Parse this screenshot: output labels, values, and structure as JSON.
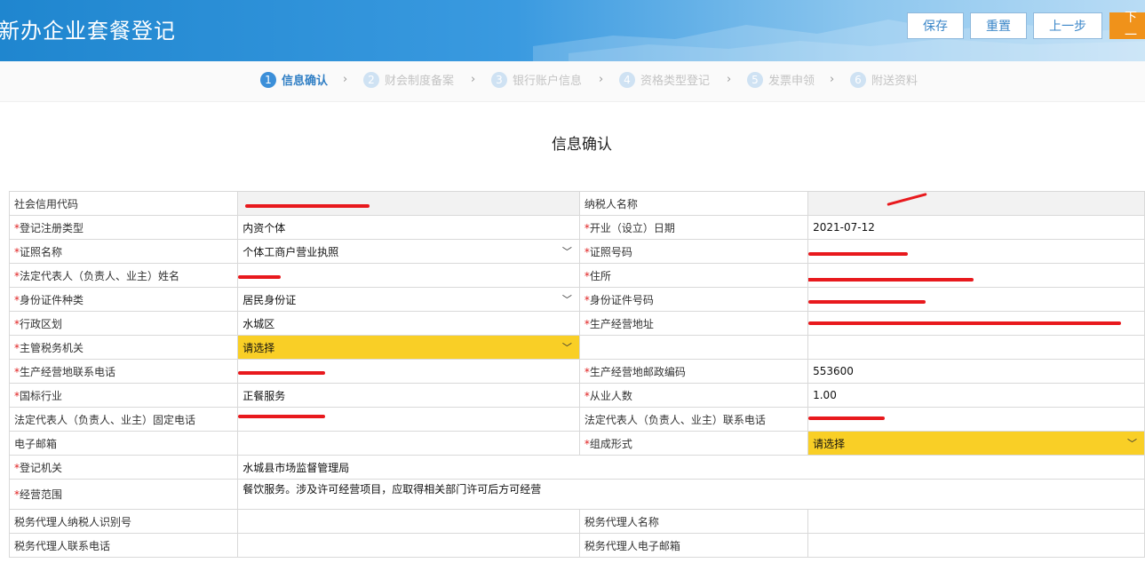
{
  "header": {
    "title": "新办企业套餐登记",
    "buttons": {
      "save": "保存",
      "reset": "重置",
      "prev": "上一步",
      "next": "下一"
    }
  },
  "steps": [
    {
      "num": "1",
      "label": "信息确认"
    },
    {
      "num": "2",
      "label": "财会制度备案"
    },
    {
      "num": "3",
      "label": "银行账户信息"
    },
    {
      "num": "4",
      "label": "资格类型登记"
    },
    {
      "num": "5",
      "label": "发票申领"
    },
    {
      "num": "6",
      "label": "附送资料"
    }
  ],
  "section_title": "信息确认",
  "form": {
    "credit_code": {
      "label": "社会信用代码",
      "value": ""
    },
    "taxpayer_name": {
      "label": "纳税人名称",
      "value": ""
    },
    "reg_type": {
      "label": "登记注册类型",
      "value": "内资个体"
    },
    "open_date": {
      "label": "开业（设立）日期",
      "value": "2021-07-12"
    },
    "license_name": {
      "label": "证照名称",
      "value": "个体工商户营业执照"
    },
    "license_no": {
      "label": "证照号码",
      "value": ""
    },
    "legal_name": {
      "label": "法定代表人（负责人、业主）姓名",
      "value": ""
    },
    "address": {
      "label": "住所",
      "value": ""
    },
    "id_type": {
      "label": "身份证件种类",
      "value": "居民身份证"
    },
    "id_no": {
      "label": "身份证件号码",
      "value": ""
    },
    "admin_region": {
      "label": "行政区划",
      "value": "水城区"
    },
    "biz_address": {
      "label": "生产经营地址",
      "value": ""
    },
    "tax_authority": {
      "label": "主管税务机关",
      "value": "请选择"
    },
    "biz_phone": {
      "label": "生产经营地联系电话",
      "value": ""
    },
    "postcode": {
      "label": "生产经营地邮政编码",
      "value": "553600"
    },
    "industry": {
      "label": "国标行业",
      "value": "正餐服务"
    },
    "employees": {
      "label": "从业人数",
      "value": "1.00"
    },
    "legal_landline": {
      "label": "法定代表人（负责人、业主）固定电话",
      "value": ""
    },
    "legal_mobile": {
      "label": "法定代表人（负责人、业主）联系电话",
      "value": ""
    },
    "email": {
      "label": "电子邮箱",
      "value": ""
    },
    "org_form": {
      "label": "组成形式",
      "value": "请选择"
    },
    "reg_authority": {
      "label": "登记机关",
      "value": "水城县市场监督管理局"
    },
    "biz_scope": {
      "label": "经营范围",
      "value": "餐饮服务。涉及许可经营项目，应取得相关部门许可后方可经营"
    },
    "agent_tax_id": {
      "label": "税务代理人纳税人识别号",
      "value": ""
    },
    "agent_name": {
      "label": "税务代理人名称",
      "value": ""
    },
    "agent_phone": {
      "label": "税务代理人联系电话",
      "value": ""
    },
    "agent_email": {
      "label": "税务代理人电子邮箱",
      "value": ""
    }
  },
  "colors": {
    "header_blue": "#1f86cf",
    "active_step": "#3b8fd9",
    "select_yellow": "#f9cf26",
    "next_orange": "#f0921a",
    "required": "#e02020"
  }
}
